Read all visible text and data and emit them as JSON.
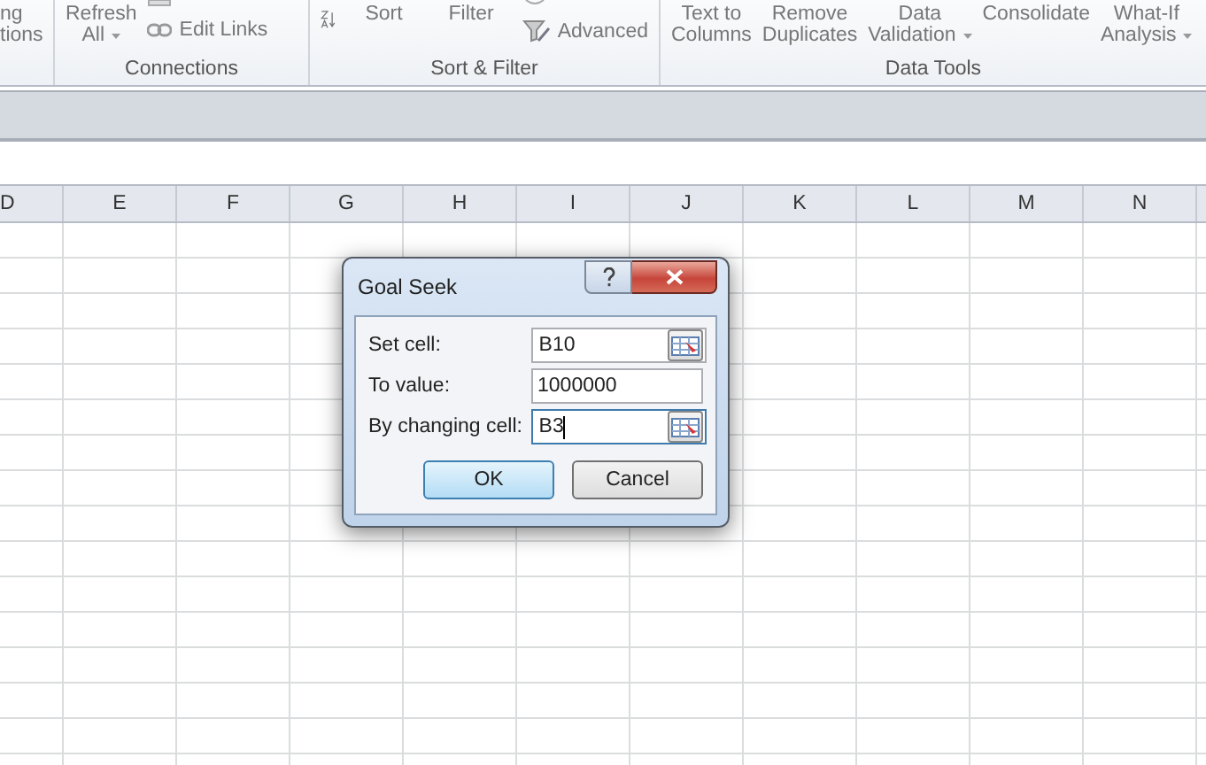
{
  "ribbon": {
    "groups": [
      {
        "items": [
          {
            "kind": "stack",
            "lines": [
              "ng",
              "tions"
            ],
            "dropdown": false
          }
        ]
      },
      {
        "label": "Connections",
        "items": [
          {
            "kind": "stack",
            "lines": [
              "Refresh",
              "All"
            ],
            "dropdown": true
          },
          {
            "kind": "link",
            "label": "Edit Links"
          }
        ]
      },
      {
        "label": "Sort & Filter",
        "items": [
          {
            "kind": "sort"
          },
          {
            "kind": "text",
            "label": "Sort"
          },
          {
            "kind": "text",
            "label": "Filter"
          },
          {
            "kind": "advanced",
            "label": "Advanced"
          }
        ]
      },
      {
        "label": "Data Tools",
        "items": [
          {
            "kind": "stack",
            "lines": [
              "Text to",
              "Columns"
            ],
            "dropdown": false
          },
          {
            "kind": "stack",
            "lines": [
              "Remove",
              "Duplicates"
            ],
            "dropdown": false
          },
          {
            "kind": "stack",
            "lines": [
              "Data",
              "Validation"
            ],
            "dropdown": true
          },
          {
            "kind": "stack",
            "lines": [
              "Consolidate"
            ],
            "dropdown": false
          },
          {
            "kind": "stack",
            "lines": [
              "What-If",
              "Analysis"
            ],
            "dropdown": true
          }
        ]
      }
    ]
  },
  "column_headers": [
    "D",
    "E",
    "F",
    "G",
    "H",
    "I",
    "J",
    "K",
    "L",
    "M",
    "N"
  ],
  "dialog": {
    "title": "Goal Seek",
    "fields": [
      {
        "label": "Set cell:",
        "value": "B10",
        "picker": true,
        "focused": false
      },
      {
        "label": "To value:",
        "value": "1000000",
        "picker": false,
        "focused": false
      },
      {
        "label": "By changing cell:",
        "value": "B3",
        "picker": true,
        "focused": true
      }
    ],
    "buttons": [
      {
        "label": "OK",
        "default": true
      },
      {
        "label": "Cancel",
        "default": false
      }
    ]
  }
}
